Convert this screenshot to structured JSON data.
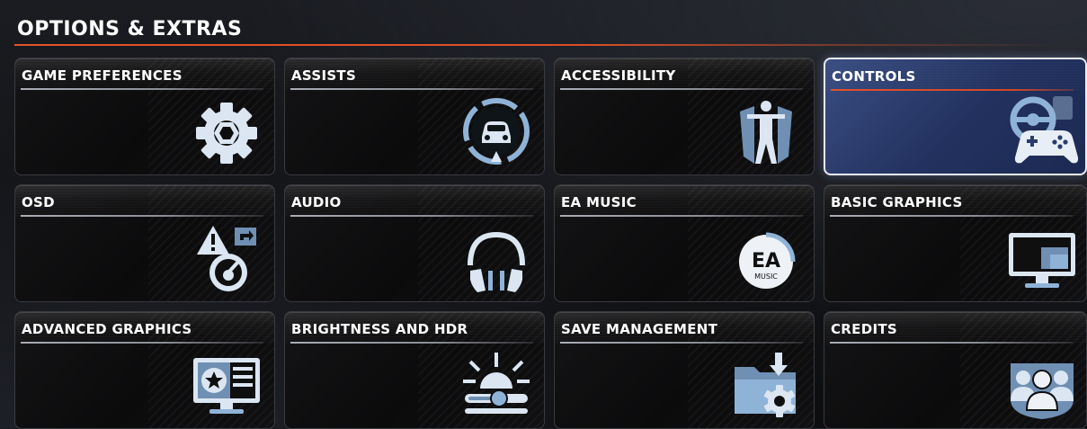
{
  "header": {
    "title": "OPTIONS & EXTRAS"
  },
  "colors": {
    "accent": "#d8502a",
    "icon": "#a9c8e4",
    "selected_bg": "#2b3c6e"
  },
  "tiles": [
    {
      "label": "GAME PREFERENCES",
      "icon": "gear-icon",
      "selected": false
    },
    {
      "label": "ASSISTS",
      "icon": "car-assist-icon",
      "selected": false
    },
    {
      "label": "ACCESSIBILITY",
      "icon": "accessibility-person-icon",
      "selected": false
    },
    {
      "label": "CONTROLS",
      "icon": "steering-wheel-gamepad-icon",
      "selected": true
    },
    {
      "label": "OSD",
      "icon": "warning-gauge-icon",
      "selected": false
    },
    {
      "label": "AUDIO",
      "icon": "headphones-icon",
      "selected": false
    },
    {
      "label": "EA MUSIC",
      "icon": "ea-music-logo-icon",
      "selected": false
    },
    {
      "label": "BASIC GRAPHICS",
      "icon": "monitor-icon",
      "selected": false
    },
    {
      "label": "ADVANCED GRAPHICS",
      "icon": "monitor-star-icon",
      "selected": false
    },
    {
      "label": "BRIGHTNESS AND HDR",
      "icon": "brightness-slider-icon",
      "selected": false
    },
    {
      "label": "SAVE MANAGEMENT",
      "icon": "folder-download-icon",
      "selected": false
    },
    {
      "label": "CREDITS",
      "icon": "people-shield-icon",
      "selected": false
    }
  ],
  "ea_logo": {
    "brand": "EA",
    "sub": "MUSIC"
  }
}
